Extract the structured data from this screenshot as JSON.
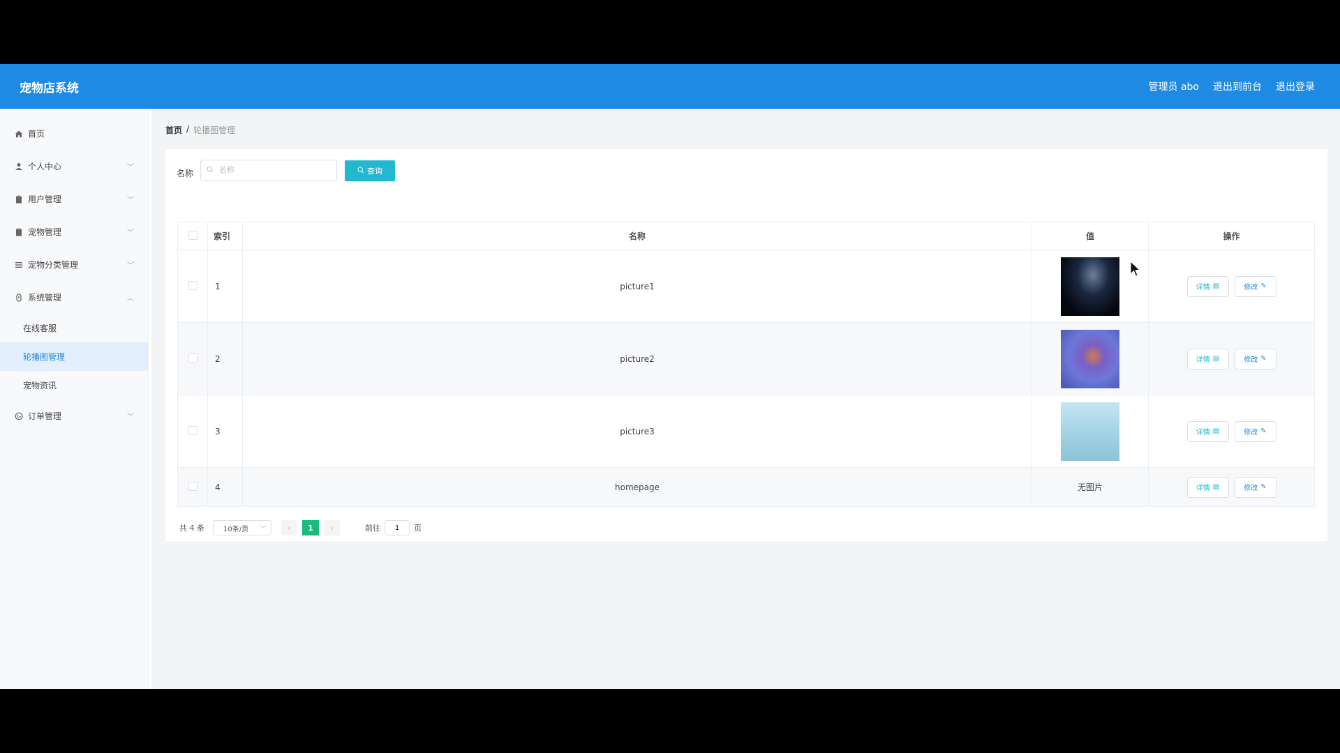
{
  "header": {
    "app_title": "宠物店系统",
    "admin_label": "管理员 abo",
    "back_to_front": "退出到前台",
    "logout": "退出登录",
    "color": "#1f8ae4"
  },
  "sidebar": {
    "items": [
      {
        "label": "首页",
        "icon": "home-icon"
      },
      {
        "label": "个人中心",
        "icon": "user-icon"
      },
      {
        "label": "用户管理",
        "icon": "clipboard-icon"
      },
      {
        "label": "宠物管理",
        "icon": "clipboard-icon"
      },
      {
        "label": "宠物分类管理",
        "icon": "list-icon"
      },
      {
        "label": "系统管理",
        "icon": "lock-icon"
      },
      {
        "label": "订单管理",
        "icon": "globe-icon"
      }
    ],
    "system_sub": [
      {
        "label": "在线客服"
      },
      {
        "label": "轮播图管理"
      },
      {
        "label": "宠物资讯"
      }
    ],
    "active_color": "#1f8ae4"
  },
  "breadcrumb": {
    "home": "首页",
    "sep": "/",
    "current": "轮播图管理"
  },
  "search": {
    "label": "名称",
    "placeholder": "名称",
    "button": "查询"
  },
  "table": {
    "headers": {
      "index": "索引",
      "name": "名称",
      "value": "值",
      "ops": "操作"
    },
    "rows": [
      {
        "index": "1",
        "name": "picture1",
        "has_image": true
      },
      {
        "index": "2",
        "name": "picture2",
        "has_image": true
      },
      {
        "index": "3",
        "name": "picture3",
        "has_image": true
      },
      {
        "index": "4",
        "name": "homepage",
        "has_image": false,
        "value_text": "无图片"
      }
    ],
    "detail_label": "详情",
    "edit_label": "修改"
  },
  "pagination": {
    "total": "共 4 条",
    "page_size": "10条/页",
    "current_page": "1",
    "goto_label": "前往",
    "goto_value": "1",
    "page_suffix": "页"
  }
}
